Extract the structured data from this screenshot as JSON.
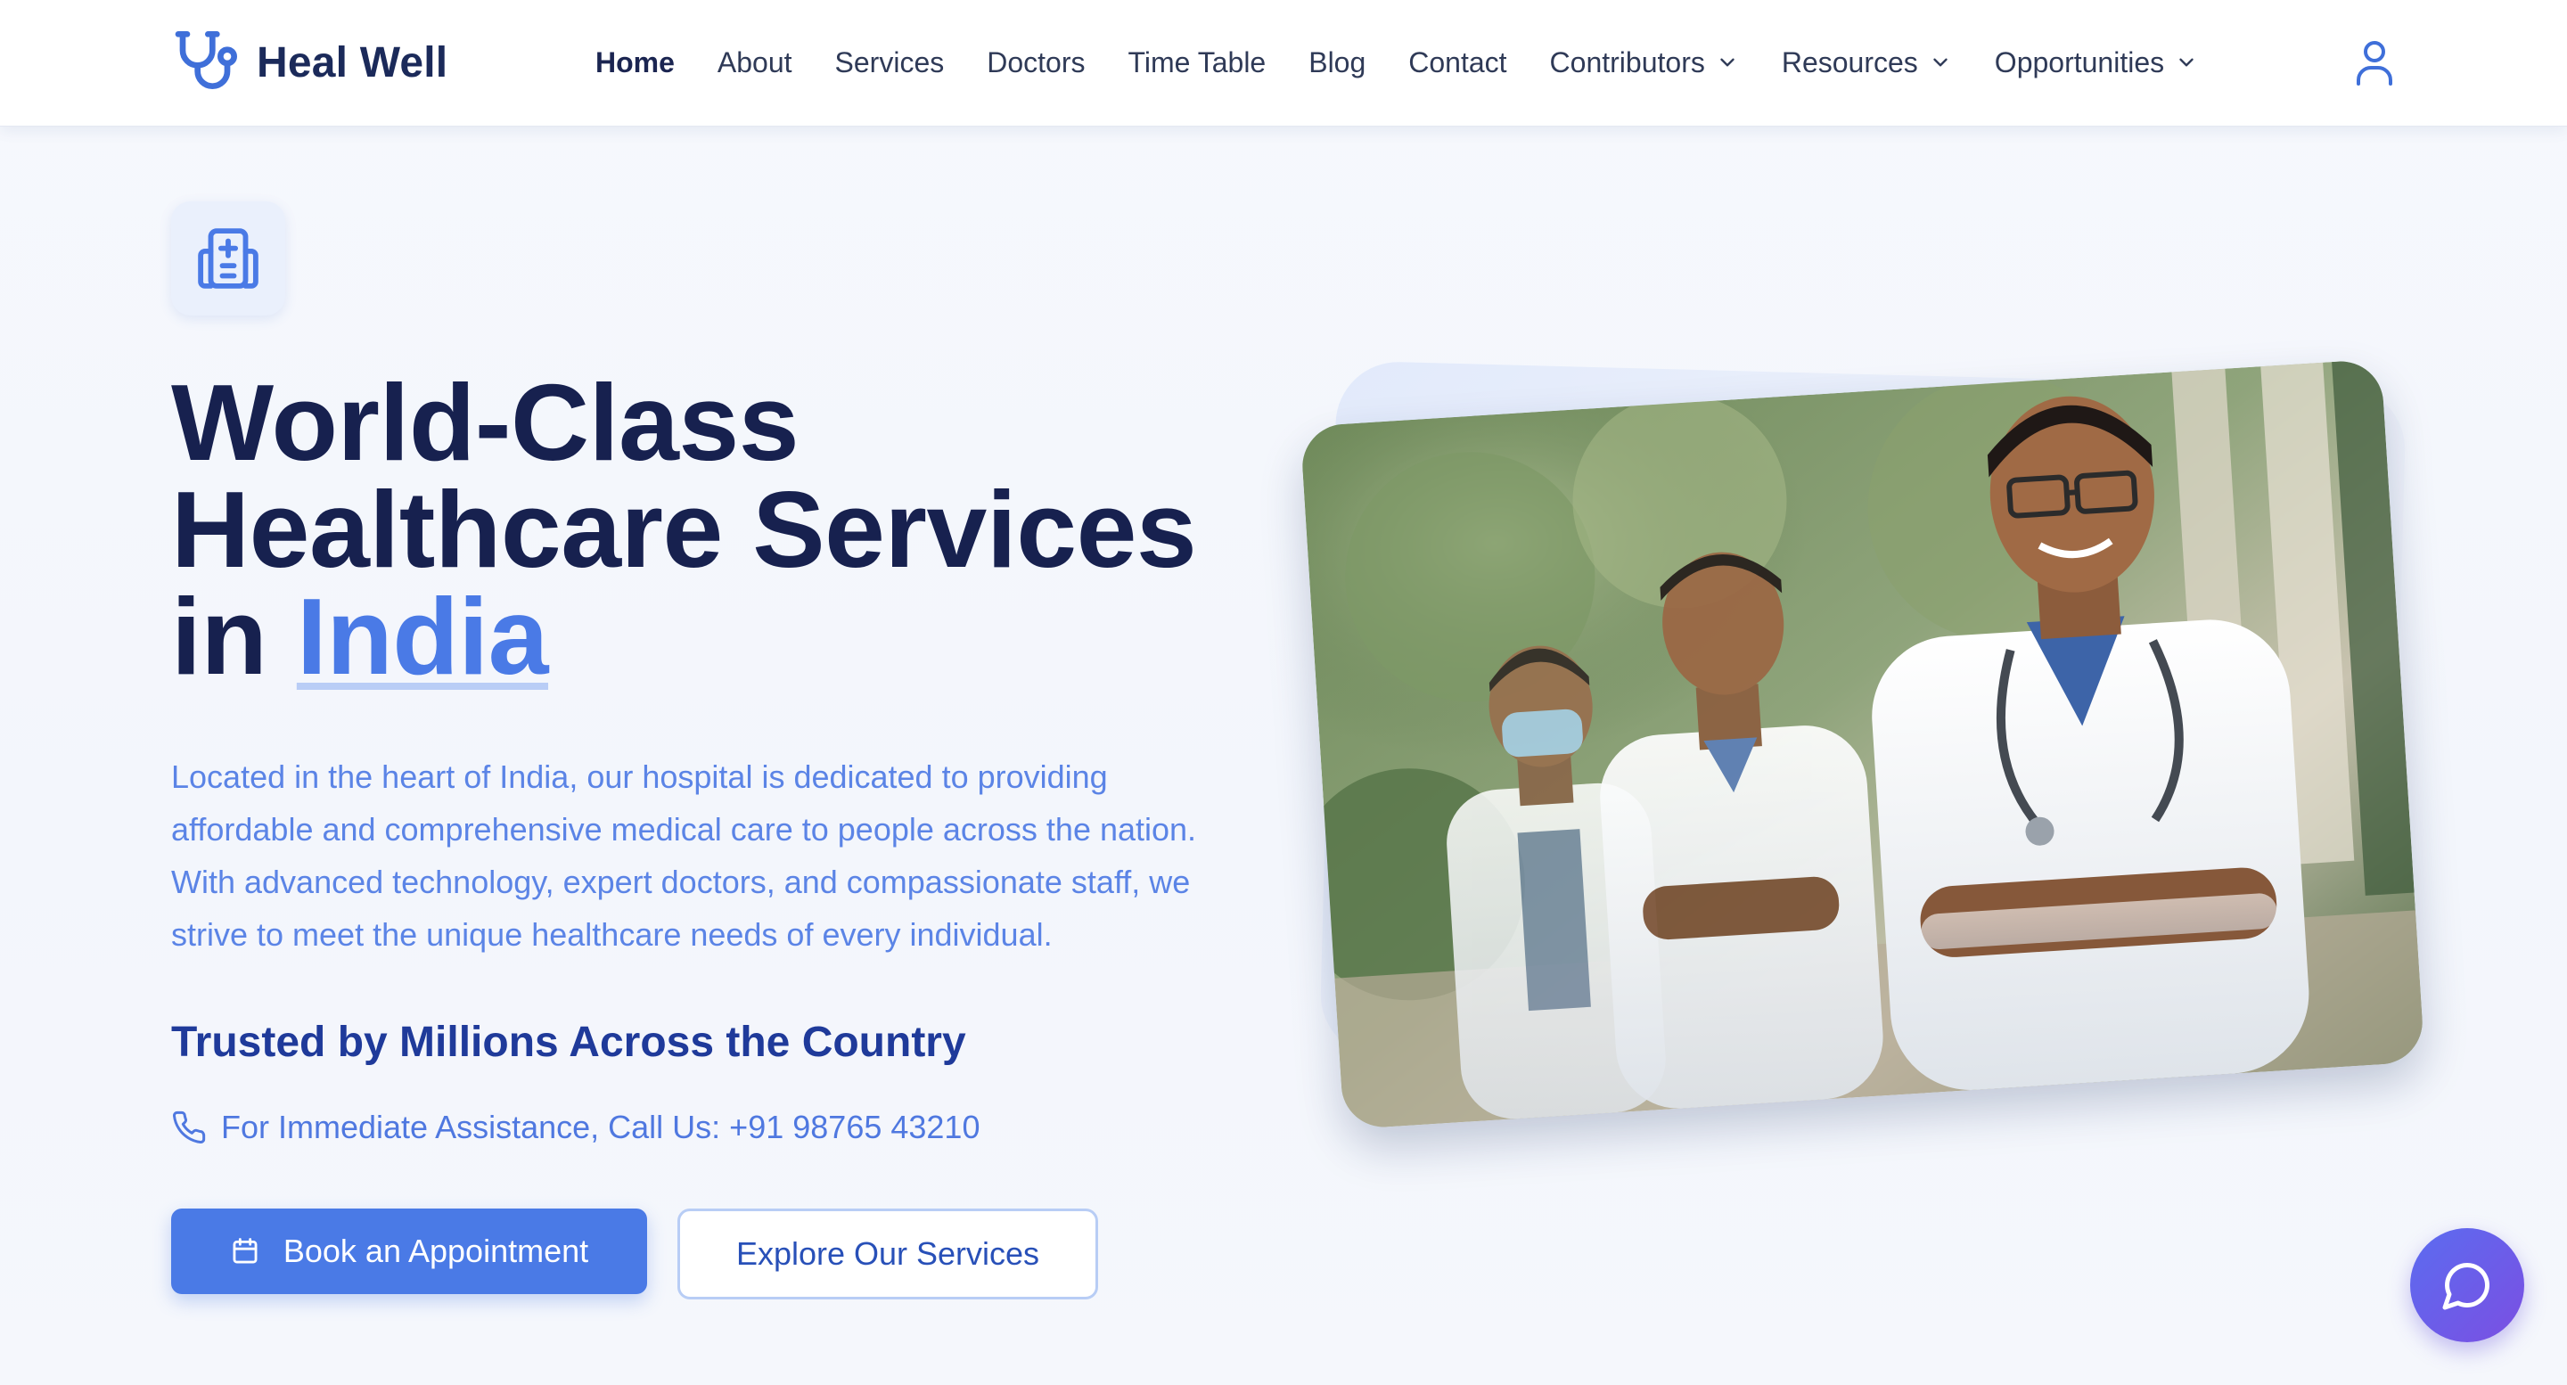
{
  "brand": {
    "name": "Heal Well",
    "icon": "stethoscope-icon"
  },
  "nav": {
    "items": [
      {
        "label": "Home",
        "active": true
      },
      {
        "label": "About"
      },
      {
        "label": "Services"
      },
      {
        "label": "Doctors"
      },
      {
        "label": "Time Table"
      },
      {
        "label": "Blog"
      },
      {
        "label": "Contact"
      },
      {
        "label": "Contributors",
        "dropdown": true
      },
      {
        "label": "Resources",
        "dropdown": true
      },
      {
        "label": "Opportunities",
        "dropdown": true
      }
    ],
    "user_icon": "user-icon"
  },
  "hero": {
    "badge_icon": "hospital-icon",
    "headline_line1": "World-Class",
    "headline_line2": "Healthcare Services",
    "headline_in": "in",
    "headline_accent": "India",
    "description": "Located in the heart of India, our hospital is dedicated to providing affordable and comprehensive medical care to people across the nation. With advanced technology, expert doctors, and compassionate staff, we strive to meet the unique healthcare needs of every individual.",
    "trusted": "Trusted by Millions Across the Country",
    "phone_text": "For Immediate Assistance, Call Us: +91 98765 43210",
    "book_button": "Book an Appointment",
    "explore_button": "Explore Our Services",
    "image_icon": "doctors-photo"
  },
  "chat": {
    "icon": "chat-bubble-icon"
  },
  "colors": {
    "accent": "#4a7ae6",
    "heading": "#17214f",
    "body_text": "#5b84e6",
    "trusted": "#1f3a9a",
    "chat_gradient_start": "#5b6cf0",
    "chat_gradient_end": "#7b4fe2"
  }
}
